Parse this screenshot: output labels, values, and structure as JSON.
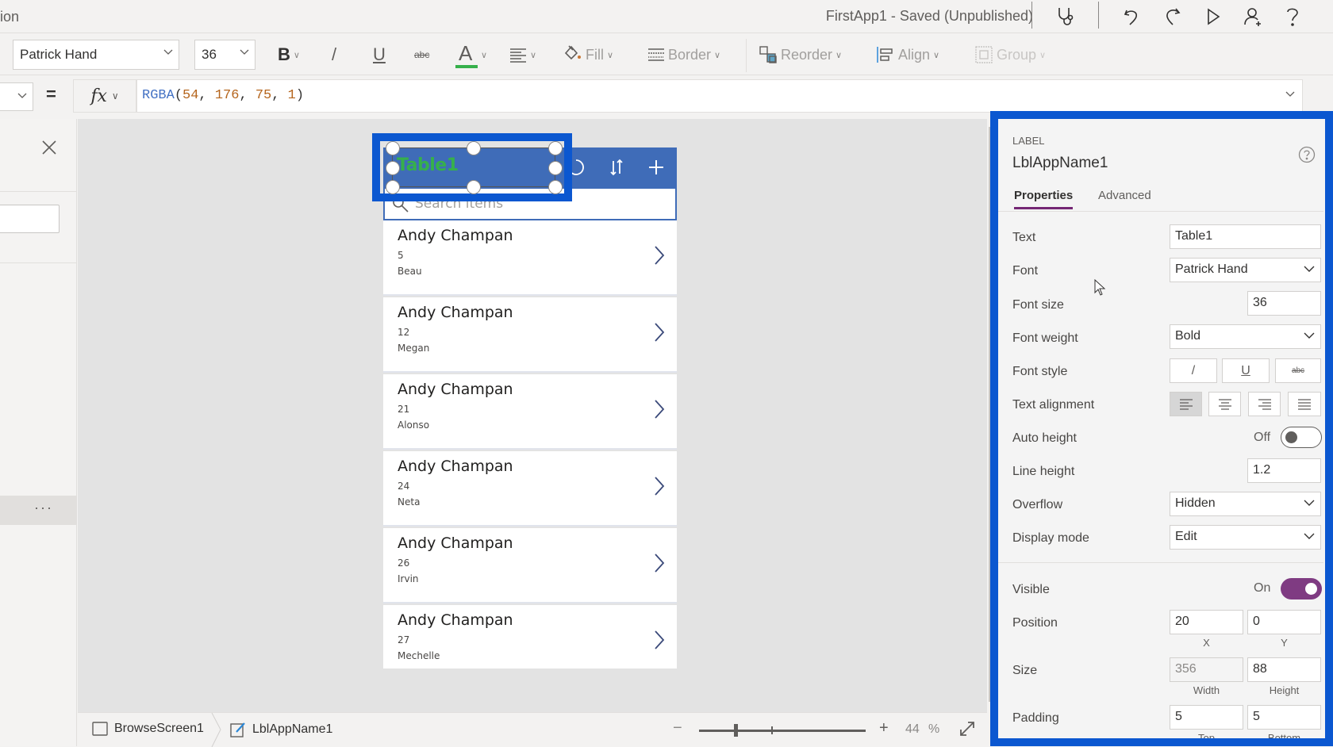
{
  "titlebar": {
    "left_text": "ion",
    "app_title": "FirstApp1 - Saved (Unpublished)",
    "icons": [
      "stethoscope-icon",
      "undo-icon",
      "redo-icon",
      "play-icon",
      "share-user-icon",
      "help-icon"
    ]
  },
  "toolbar": {
    "font_value": "Patrick Hand",
    "font_size_value": "36",
    "bold_label": "B",
    "italic_label": "/",
    "underline_label": "U",
    "strikethrough_label": "abc",
    "font_color_label": "A",
    "font_color": "#36b04b",
    "fill_label": "Fill",
    "border_label": "Border",
    "reorder_label": "Reorder",
    "align_label": "Align",
    "group_label": "Group"
  },
  "formula_bar": {
    "equals": "=",
    "fx_label": "fx",
    "formula": {
      "fn": "RGBA",
      "open": "(",
      "args": [
        "54",
        "176",
        "75",
        "1"
      ],
      "sep": ", ",
      "close": ")"
    }
  },
  "left_panel": {
    "more_label": "···"
  },
  "app_preview": {
    "header_title": "Table1",
    "header_color": "#3f6cb8",
    "title_color": "#36b04b",
    "search_placeholder": "Search items",
    "items": [
      {
        "title": "Andy Champan",
        "subtitle": "5",
        "body": "Beau"
      },
      {
        "title": "Andy Champan",
        "subtitle": "12",
        "body": "Megan"
      },
      {
        "title": "Andy Champan",
        "subtitle": "21",
        "body": "Alonso"
      },
      {
        "title": "Andy Champan",
        "subtitle": "24",
        "body": "Neta"
      },
      {
        "title": "Andy Champan",
        "subtitle": "26",
        "body": "Irvin"
      },
      {
        "title": "Andy Champan",
        "subtitle": "27",
        "body": "Mechelle"
      }
    ]
  },
  "bottombar": {
    "screen_crumb": "BrowseScreen1",
    "control_crumb": "LblAppName1",
    "zoom_minus": "−",
    "zoom_plus": "+",
    "zoom_value": "44",
    "zoom_unit": "%"
  },
  "properties_panel": {
    "control_type": "LABEL",
    "control_name": "LblAppName1",
    "tabs": [
      {
        "label": "Properties",
        "active": true
      },
      {
        "label": "Advanced",
        "active": false
      }
    ],
    "rows": {
      "text": {
        "label": "Text",
        "value": "Table1"
      },
      "font": {
        "label": "Font",
        "value": "Patrick Hand"
      },
      "font_size": {
        "label": "Font size",
        "value": "36"
      },
      "font_weight": {
        "label": "Font weight",
        "value": "Bold"
      },
      "font_style": {
        "label": "Font style",
        "italic": "/",
        "underline": "U",
        "strike": "abc"
      },
      "text_alignment": {
        "label": "Text alignment",
        "selected": "left"
      },
      "auto_height": {
        "label": "Auto height",
        "state": "Off"
      },
      "line_height": {
        "label": "Line height",
        "value": "1.2"
      },
      "overflow": {
        "label": "Overflow",
        "value": "Hidden"
      },
      "display_mode": {
        "label": "Display mode",
        "value": "Edit"
      },
      "visible": {
        "label": "Visible",
        "state": "On"
      },
      "position": {
        "label": "Position",
        "x": "20",
        "y": "0",
        "x_label": "X",
        "y_label": "Y"
      },
      "size": {
        "label": "Size",
        "width": "356",
        "height": "88",
        "width_label": "Width",
        "height_label": "Height"
      },
      "padding": {
        "label": "Padding",
        "top": "5",
        "bottom": "5",
        "top_label": "Top",
        "bottom_label": "Bottom"
      }
    },
    "toggle_on_color": "#7f3b82"
  },
  "highlight_color": "#0b57d0"
}
